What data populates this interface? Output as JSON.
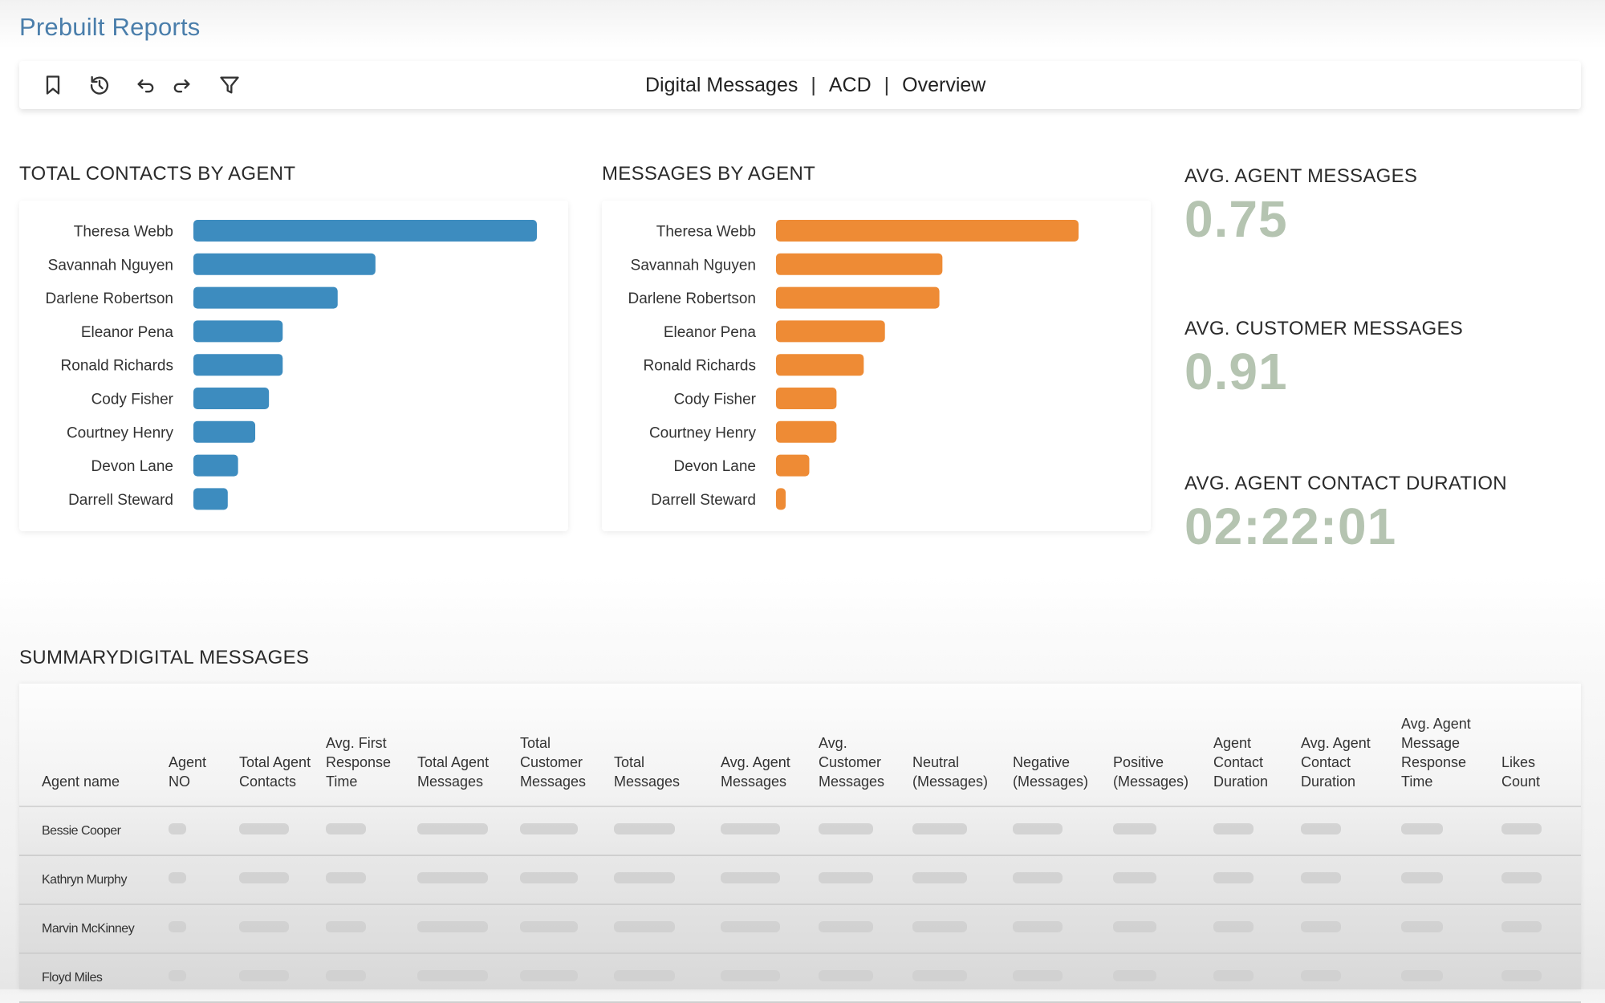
{
  "page": {
    "title": "Prebuilt Reports"
  },
  "toolbar": {
    "icons": [
      "bookmark-icon",
      "history-icon",
      "undo-icon",
      "redo-icon",
      "filter-icon"
    ],
    "breadcrumb": [
      "Digital Messages",
      "ACD",
      "Overview"
    ],
    "separator": "|"
  },
  "colors": {
    "title": "#4a7eab",
    "contacts_bar": "#3d8cbf",
    "messages_bar": "#ee8b35",
    "kpi_value": "#b5c4b1"
  },
  "chart_data": [
    {
      "type": "bar",
      "orientation": "horizontal",
      "title": "TOTAL CONTACTS BY AGENT",
      "xlabel": "",
      "ylabel": "",
      "axis": "none",
      "grid": false,
      "categories": [
        "Theresa Webb",
        "Savannah Nguyen",
        "Darlene Robertson",
        "Eleanor Pena",
        "Ronald Richards",
        "Cody Fisher",
        "Courtney Henry",
        "Devon Lane",
        "Darrell Steward"
      ],
      "values": [
        100,
        53,
        42,
        26,
        26,
        22,
        18,
        13,
        10
      ],
      "value_units": "relative (max = 100), no axis shown",
      "xlim": [
        0,
        100
      ]
    },
    {
      "type": "bar",
      "orientation": "horizontal",
      "title": "MESSAGES BY AGENT",
      "xlabel": "",
      "ylabel": "",
      "axis": "none",
      "grid": false,
      "categories": [
        "Theresa Webb",
        "Savannah Nguyen",
        "Darlene Robertson",
        "Eleanor Pena",
        "Ronald Richards",
        "Cody Fisher",
        "Courtney Henry",
        "Devon Lane",
        "Darrell Steward"
      ],
      "values": [
        100,
        55,
        54,
        36,
        29,
        20,
        20,
        11,
        3
      ],
      "value_units": "relative (max = 100), no axis shown",
      "xlim": [
        0,
        100
      ]
    }
  ],
  "kpis": [
    {
      "label": "AVG. AGENT MESSAGES",
      "value": "0.75"
    },
    {
      "label": "AVG. CUSTOMER MESSAGES",
      "value": "0.91"
    },
    {
      "label": "AVG. AGENT CONTACT DURATION",
      "value": "02:22:01"
    }
  ],
  "summary": {
    "title": "SUMMARYDIGITAL MESSAGES",
    "columns": [
      "Agent name",
      "Agent NO",
      "Total Agent Contacts",
      "Avg. First Response Time",
      "Total Agent Messages",
      "Total Customer Messages",
      "Total Messages",
      "Avg. Agent Messages",
      "Avg. Customer Messages",
      "Neutral (Messages)",
      "Negative (Messages)",
      "Positive (Messages)",
      "Agent Contact Duration",
      "Avg. Agent Contact Duration",
      "Avg. Agent Message Response Time",
      "Likes Count"
    ],
    "rows": [
      {
        "name": "Bessie Cooper",
        "cells": "loading"
      },
      {
        "name": "Kathryn Murphy",
        "cells": "loading"
      },
      {
        "name": "Marvin McKinney",
        "cells": "loading"
      },
      {
        "name": "Floyd Miles",
        "cells": "loading"
      }
    ]
  }
}
